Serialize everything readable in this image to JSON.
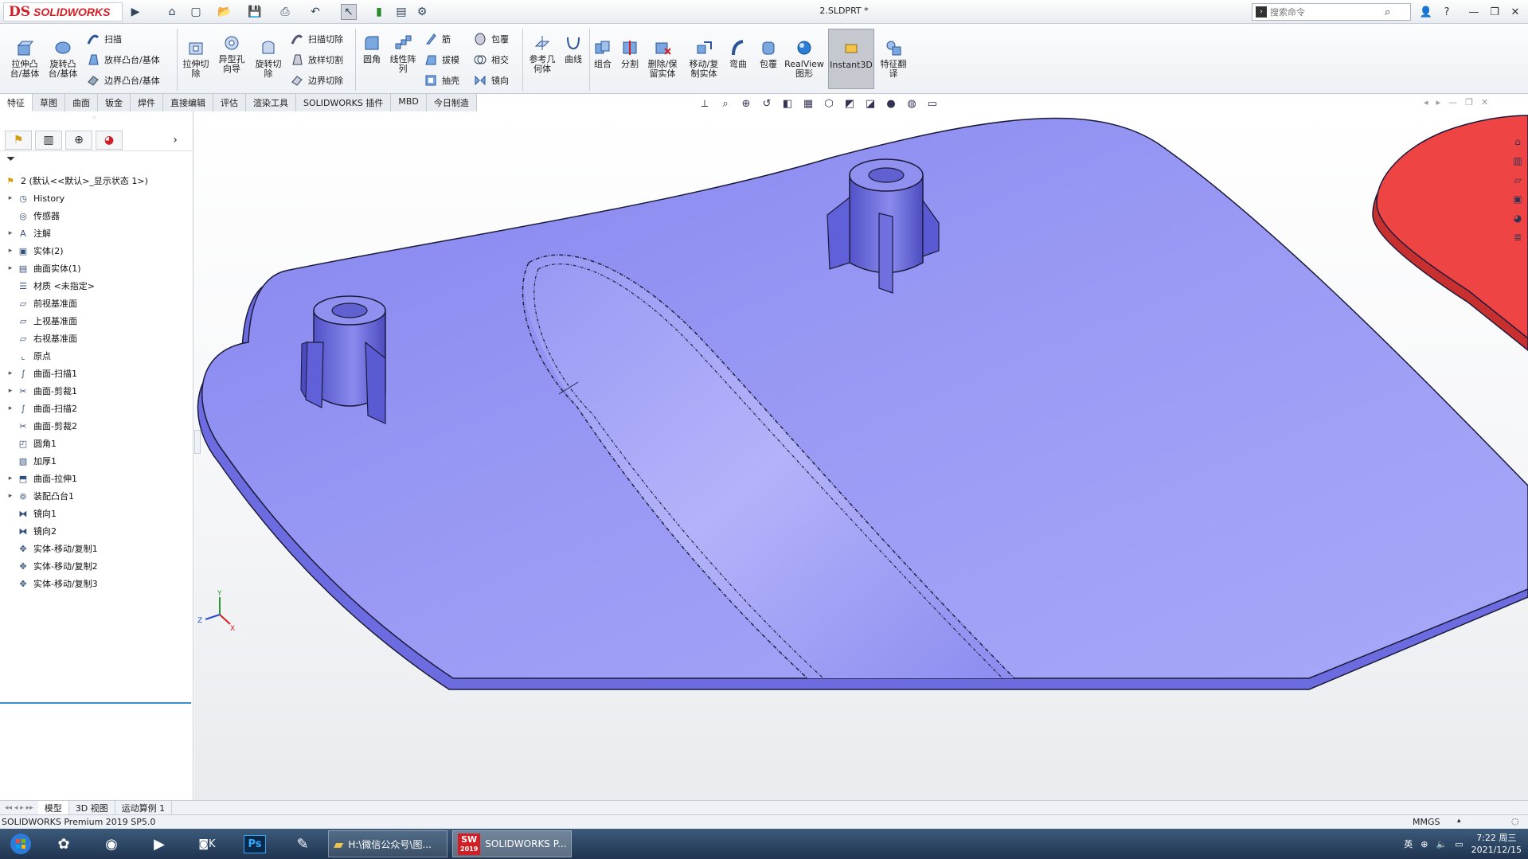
{
  "app": {
    "brand_ds": "DS",
    "brand_name": "SOLIDWORKS",
    "doc_title": "2.SLDPRT *",
    "search_placeholder": "搜索命令"
  },
  "colors": {
    "part_fill": "#9b9bf5",
    "part_edge": "#1a1a3a",
    "other_body": "#ee4444",
    "accent_red": "#d21f26"
  },
  "quick_access": [
    "home-icon",
    "new-doc-icon",
    "open-icon",
    "save-icon",
    "print-icon",
    "undo-icon",
    "select-icon",
    "rebuild-icon",
    "options-icon"
  ],
  "ribbon": {
    "extrude_boss": "拉伸凸\n台/基体",
    "revolve_boss": "旋转凸\n台/基体",
    "sweep": "扫描",
    "loft_boss": "放样凸台/基体",
    "boundary_boss": "边界凸台/基体",
    "extrude_cut": "拉伸切\n除",
    "hole_wizard": "异型孔\n向导",
    "revolve_cut": "旋转切\n除",
    "swept_cut": "扫描切除",
    "lofted_cut": "放样切割",
    "boundary_cut": "边界切除",
    "fillet": "圆角",
    "linear_pattern": "线性阵\n列",
    "rib": "筋",
    "draft": "拔模",
    "shell": "抽壳",
    "wrap": "包覆",
    "intersect": "相交",
    "mirror": "镜向",
    "ref_geometry": "参考几\n何体",
    "curves": "曲线",
    "combine": "组合",
    "split": "分割",
    "delete_keep": "删除/保\n留实体",
    "move_copy": "移动/复\n制实体",
    "flex": "弯曲",
    "wrap2": "包覆",
    "realview": "RealView\n图形",
    "instant3d": "Instant3D",
    "feature_translate": "特征翻\n译"
  },
  "tabs": [
    "特征",
    "草图",
    "曲面",
    "钣金",
    "焊件",
    "直接编辑",
    "评估",
    "渲染工具",
    "SOLIDWORKS 插件",
    "MBD",
    "今日制造"
  ],
  "active_tab": "特征",
  "tree": {
    "root": "2  (默认<<默认>_显示状态 1>)",
    "items": [
      {
        "label": "History",
        "icon": "history-icon",
        "expand": true
      },
      {
        "label": "传感器",
        "icon": "sensor-icon",
        "expand": false
      },
      {
        "label": "注解",
        "icon": "annotation-icon",
        "expand": true
      },
      {
        "label": "实体(2)",
        "icon": "solid-bodies-icon",
        "expand": true
      },
      {
        "label": "曲面实体(1)",
        "icon": "surface-bodies-icon",
        "expand": true
      },
      {
        "label": "材质 <未指定>",
        "icon": "material-icon",
        "expand": false
      },
      {
        "label": "前视基准面",
        "icon": "plane-icon",
        "expand": false
      },
      {
        "label": "上视基准面",
        "icon": "plane-icon",
        "expand": false
      },
      {
        "label": "右视基准面",
        "icon": "plane-icon",
        "expand": false
      },
      {
        "label": "原点",
        "icon": "origin-icon",
        "expand": false
      },
      {
        "label": "曲面-扫描1",
        "icon": "sweep-icon",
        "expand": true
      },
      {
        "label": "曲面-剪裁1",
        "icon": "trim-icon",
        "expand": true
      },
      {
        "label": "曲面-扫描2",
        "icon": "sweep-icon",
        "expand": true
      },
      {
        "label": "曲面-剪裁2",
        "icon": "trim-icon",
        "expand": false
      },
      {
        "label": "圆角1",
        "icon": "fillet-icon",
        "expand": false
      },
      {
        "label": "加厚1",
        "icon": "thicken-icon",
        "expand": false
      },
      {
        "label": "曲面-拉伸1",
        "icon": "extrude-icon",
        "expand": true
      },
      {
        "label": "装配凸台1",
        "icon": "mount-boss-icon",
        "expand": true
      },
      {
        "label": "镜向1",
        "icon": "mirror-icon",
        "expand": false
      },
      {
        "label": "镜向2",
        "icon": "mirror-icon",
        "expand": false
      },
      {
        "label": "实体-移动/复制1",
        "icon": "move-copy-icon",
        "expand": false
      },
      {
        "label": "实体-移动/复制2",
        "icon": "move-copy-icon",
        "expand": false
      },
      {
        "label": "实体-移动/复制3",
        "icon": "move-copy-icon",
        "expand": false
      }
    ]
  },
  "bottom_tabs": [
    "模型",
    "3D 视图",
    "运动算例 1"
  ],
  "status": {
    "left": "SOLIDWORKS Premium 2019 SP5.0",
    "units": "MMGS"
  },
  "taskbar": {
    "active_window": "SOLIDWORKS P...",
    "folder_window": "H:\\微信公众号\\图...",
    "sw_year": "2019",
    "time": "7:22 周三",
    "date": "2021/12/15"
  }
}
